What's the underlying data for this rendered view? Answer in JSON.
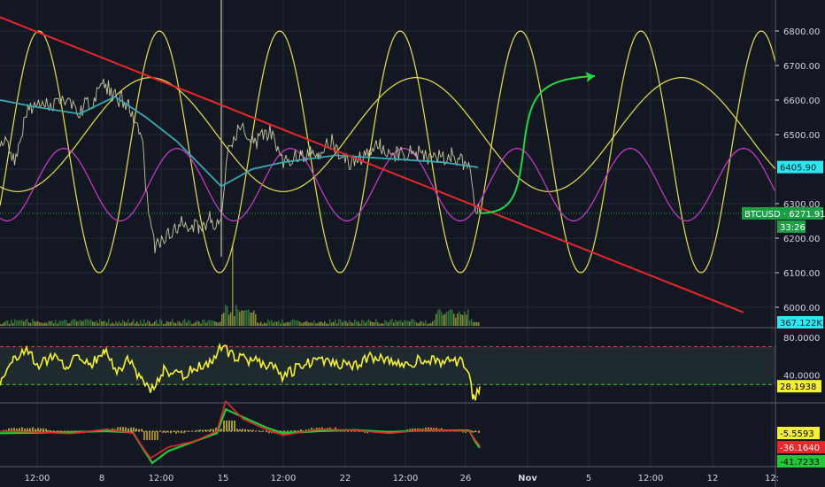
{
  "chart_data": {
    "type": "line",
    "symbol": "BTCUSD",
    "colors": {
      "background": "#131722",
      "grid": "#262a35",
      "price": "#c8c8a0",
      "trendline": "#e8262c",
      "sine_yellow": "#e8e24a",
      "sine_magenta": "#c238c8",
      "moving_average": "#3aa8b5",
      "projection": "#22d845",
      "rsi": "#f5f036",
      "macd_main": "#e8262c",
      "macd_signal": "#22c838",
      "volume": "#a3a840",
      "last_price_tag": "#1e9f46",
      "ma_tag": "#2ee6f0",
      "rsi_tag": "#f5f036"
    },
    "main_pane": {
      "y_ticks": [
        "6000.00",
        "6100.00",
        "6200.00",
        "6300.00",
        "6500.00",
        "6600.00",
        "6700.00",
        "6800.00"
      ],
      "ylim": [
        5985,
        6855
      ],
      "ma_value_label": "6405.90",
      "last_price_label": "BTCUSD · 6271.91",
      "countdown_label": "33:26",
      "volume_label": "367.122K",
      "price_series": [
        [
          0,
          6490
        ],
        [
          18,
          6430
        ],
        [
          30,
          6560
        ],
        [
          45,
          6590
        ],
        [
          60,
          6580
        ],
        [
          75,
          6610
        ],
        [
          90,
          6570
        ],
        [
          105,
          6600
        ],
        [
          118,
          6650
        ],
        [
          130,
          6610
        ],
        [
          145,
          6590
        ],
        [
          160,
          6500
        ],
        [
          168,
          6250
        ],
        [
          175,
          6180
        ],
        [
          190,
          6220
        ],
        [
          205,
          6240
        ],
        [
          225,
          6230
        ],
        [
          238,
          6260
        ],
        [
          248,
          6230
        ],
        [
          258,
          6470
        ],
        [
          270,
          6520
        ],
        [
          290,
          6480
        ],
        [
          305,
          6510
        ],
        [
          320,
          6420
        ],
        [
          340,
          6440
        ],
        [
          360,
          6450
        ],
        [
          375,
          6480
        ],
        [
          390,
          6420
        ],
        [
          410,
          6430
        ],
        [
          430,
          6470
        ],
        [
          450,
          6440
        ],
        [
          470,
          6450
        ],
        [
          490,
          6430
        ],
        [
          510,
          6440
        ],
        [
          530,
          6410
        ],
        [
          536,
          6290
        ],
        [
          542,
          6272
        ]
      ],
      "ma_series": [
        [
          0,
          6600
        ],
        [
          40,
          6580
        ],
        [
          90,
          6560
        ],
        [
          130,
          6610
        ],
        [
          165,
          6550
        ],
        [
          200,
          6480
        ],
        [
          250,
          6350
        ],
        [
          285,
          6400
        ],
        [
          320,
          6420
        ],
        [
          380,
          6440
        ],
        [
          440,
          6430
        ],
        [
          500,
          6420
        ],
        [
          540,
          6405
        ]
      ],
      "trendline": [
        [
          0,
          6840
        ],
        [
          840,
          5985
        ]
      ],
      "projection": [
        [
          542,
          6272
        ],
        [
          570,
          6300
        ],
        [
          585,
          6420
        ],
        [
          600,
          6610
        ],
        [
          630,
          6660
        ],
        [
          672,
          6670
        ]
      ],
      "sine_magenta": {
        "center": 6355,
        "amplitude": 105,
        "period": 128,
        "phase": 40
      },
      "sine_yellow_fast": {
        "center": 6450,
        "amplitude": 350,
        "period": 136,
        "phase": 10
      },
      "sine_yellow_slow": {
        "center": 6500,
        "amplitude": 165,
        "period": 300,
        "phase": 95
      }
    },
    "rsi_pane": {
      "y_ticks": [
        "80.0000",
        "40.0000"
      ],
      "ylim": [
        0,
        85
      ],
      "overbought": 70,
      "oversold": 30,
      "value_label": "28.1938",
      "series": [
        [
          0,
          35
        ],
        [
          15,
          55
        ],
        [
          30,
          65
        ],
        [
          45,
          50
        ],
        [
          60,
          60
        ],
        [
          75,
          48
        ],
        [
          90,
          62
        ],
        [
          105,
          52
        ],
        [
          118,
          68
        ],
        [
          130,
          45
        ],
        [
          145,
          55
        ],
        [
          160,
          35
        ],
        [
          170,
          25
        ],
        [
          185,
          45
        ],
        [
          205,
          40
        ],
        [
          225,
          50
        ],
        [
          240,
          55
        ],
        [
          250,
          72
        ],
        [
          265,
          58
        ],
        [
          285,
          55
        ],
        [
          305,
          50
        ],
        [
          320,
          38
        ],
        [
          340,
          50
        ],
        [
          360,
          58
        ],
        [
          380,
          52
        ],
        [
          400,
          48
        ],
        [
          420,
          60
        ],
        [
          440,
          55
        ],
        [
          460,
          52
        ],
        [
          480,
          58
        ],
        [
          500,
          54
        ],
        [
          520,
          55
        ],
        [
          530,
          40
        ],
        [
          535,
          15
        ],
        [
          542,
          28
        ]
      ]
    },
    "macd_pane": {
      "value_labels": [
        "-5.5593",
        "-36.1640",
        "-41.7233"
      ],
      "macd_series": [
        [
          0,
          0
        ],
        [
          40,
          -2
        ],
        [
          80,
          -6
        ],
        [
          120,
          5
        ],
        [
          150,
          -5
        ],
        [
          170,
          -68
        ],
        [
          190,
          -40
        ],
        [
          220,
          -25
        ],
        [
          245,
          0
        ],
        [
          255,
          75
        ],
        [
          275,
          30
        ],
        [
          300,
          5
        ],
        [
          320,
          -10
        ],
        [
          360,
          5
        ],
        [
          400,
          2
        ],
        [
          440,
          -5
        ],
        [
          480,
          3
        ],
        [
          530,
          0
        ],
        [
          538,
          -25
        ],
        [
          542,
          -36
        ]
      ],
      "signal_series": [
        [
          0,
          -5
        ],
        [
          40,
          -4
        ],
        [
          80,
          -2
        ],
        [
          120,
          0
        ],
        [
          150,
          -3
        ],
        [
          172,
          -80
        ],
        [
          190,
          -50
        ],
        [
          220,
          -25
        ],
        [
          245,
          -5
        ],
        [
          255,
          55
        ],
        [
          275,
          35
        ],
        [
          300,
          10
        ],
        [
          320,
          -5
        ],
        [
          360,
          0
        ],
        [
          400,
          3
        ],
        [
          440,
          -2
        ],
        [
          480,
          2
        ],
        [
          530,
          2
        ],
        [
          538,
          -30
        ],
        [
          542,
          -42
        ]
      ]
    },
    "x_ticks": [
      "12:00",
      "8",
      "12:00",
      "15",
      "12:00",
      "22",
      "12:00",
      "26",
      "Nov",
      "5",
      "12:00",
      "12",
      "12:"
    ]
  }
}
